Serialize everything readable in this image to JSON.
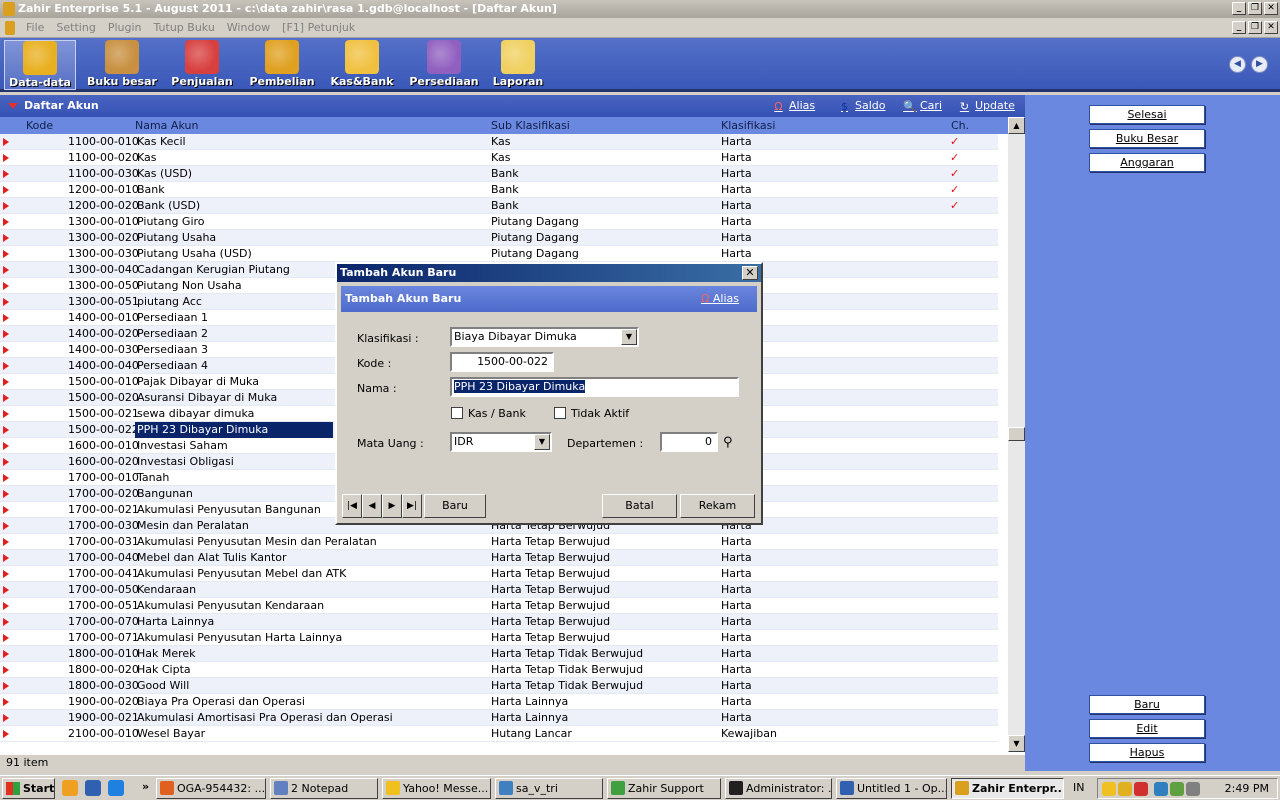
{
  "window": {
    "title": "Zahir Enterprise 5.1 - August 2011 - c:\\data zahir\\rasa 1.gdb@localhost - [Daftar Akun]"
  },
  "menu": [
    "File",
    "Setting",
    "Plugin",
    "Tutup Buku",
    "Window",
    "[F1] Petunjuk"
  ],
  "modules": [
    {
      "label": "Data-data",
      "icon": "data-data-icon",
      "color": "#e8b020"
    },
    {
      "label": "Buku besar",
      "icon": "buku-besar-icon",
      "color": "#c89040"
    },
    {
      "label": "Penjualan",
      "icon": "penjualan-icon",
      "color": "#d84040"
    },
    {
      "label": "Pembelian",
      "icon": "pembelian-icon",
      "color": "#e0a020"
    },
    {
      "label": "Kas&Bank",
      "icon": "kas-bank-icon",
      "color": "#f0c040"
    },
    {
      "label": "Persediaan",
      "icon": "persediaan-icon",
      "color": "#9060c0"
    },
    {
      "label": "Laporan",
      "icon": "laporan-icon",
      "color": "#f0d060"
    }
  ],
  "list": {
    "title": "Daftar Akun",
    "actions": {
      "alias": "Alias",
      "saldo": "Saldo",
      "cari": "Cari",
      "update": "Update"
    },
    "columns": {
      "kode": "Kode",
      "nama": "Nama Akun",
      "sub": "Sub Klasifikasi",
      "klasifikasi": "Klasifikasi",
      "ch": "Ch."
    },
    "rows": [
      {
        "kode": "1100-00-010",
        "nama": "Kas Kecil",
        "sub": "Kas",
        "kla": "Harta",
        "ch": "✓"
      },
      {
        "kode": "1100-00-020",
        "nama": "Kas",
        "sub": "Kas",
        "kla": "Harta",
        "ch": "✓"
      },
      {
        "kode": "1100-00-030",
        "nama": "Kas (USD)",
        "sub": "Bank",
        "kla": "Harta",
        "ch": "✓"
      },
      {
        "kode": "1200-00-010",
        "nama": "Bank",
        "sub": "Bank",
        "kla": "Harta",
        "ch": "✓"
      },
      {
        "kode": "1200-00-020",
        "nama": "Bank (USD)",
        "sub": "Bank",
        "kla": "Harta",
        "ch": "✓"
      },
      {
        "kode": "1300-00-010",
        "nama": "Piutang Giro",
        "sub": "Piutang Dagang",
        "kla": "Harta",
        "ch": ""
      },
      {
        "kode": "1300-00-020",
        "nama": "Piutang Usaha",
        "sub": "Piutang Dagang",
        "kla": "Harta",
        "ch": ""
      },
      {
        "kode": "1300-00-030",
        "nama": "Piutang Usaha (USD)",
        "sub": "Piutang Dagang",
        "kla": "Harta",
        "ch": ""
      },
      {
        "kode": "1300-00-040",
        "nama": "Cadangan Kerugian Piutang",
        "sub": "",
        "kla": "",
        "ch": ""
      },
      {
        "kode": "1300-00-050",
        "nama": "Piutang Non Usaha",
        "sub": "",
        "kla": "",
        "ch": ""
      },
      {
        "kode": "1300-00-051",
        "nama": "piutang Acc",
        "sub": "",
        "kla": "",
        "ch": ""
      },
      {
        "kode": "1400-00-010",
        "nama": "Persediaan 1",
        "sub": "",
        "kla": "",
        "ch": ""
      },
      {
        "kode": "1400-00-020",
        "nama": "Persediaan 2",
        "sub": "",
        "kla": "",
        "ch": ""
      },
      {
        "kode": "1400-00-030",
        "nama": "Persediaan 3",
        "sub": "",
        "kla": "",
        "ch": ""
      },
      {
        "kode": "1400-00-040",
        "nama": "Persediaan 4",
        "sub": "",
        "kla": "",
        "ch": ""
      },
      {
        "kode": "1500-00-010",
        "nama": "Pajak Dibayar di Muka",
        "sub": "",
        "kla": "",
        "ch": ""
      },
      {
        "kode": "1500-00-020",
        "nama": "Asuransi Dibayar di Muka",
        "sub": "",
        "kla": "",
        "ch": ""
      },
      {
        "kode": "1500-00-021",
        "nama": "sewa dibayar dimuka",
        "sub": "",
        "kla": "",
        "ch": ""
      },
      {
        "kode": "1500-00-022",
        "nama": "PPH 23 Dibayar Dimuka",
        "sub": "",
        "kla": "",
        "ch": "",
        "selected": true
      },
      {
        "kode": "1600-00-010",
        "nama": "Investasi Saham",
        "sub": "",
        "kla": "",
        "ch": ""
      },
      {
        "kode": "1600-00-020",
        "nama": "Investasi Obligasi",
        "sub": "",
        "kla": "",
        "ch": ""
      },
      {
        "kode": "1700-00-010",
        "nama": "Tanah",
        "sub": "",
        "kla": "",
        "ch": ""
      },
      {
        "kode": "1700-00-020",
        "nama": "Bangunan",
        "sub": "",
        "kla": "",
        "ch": ""
      },
      {
        "kode": "1700-00-021",
        "nama": "Akumulasi Penyusutan Bangunan",
        "sub": "",
        "kla": "",
        "ch": ""
      },
      {
        "kode": "1700-00-030",
        "nama": "Mesin dan Peralatan",
        "sub": "Harta Tetap Berwujud",
        "kla": "Harta",
        "ch": ""
      },
      {
        "kode": "1700-00-031",
        "nama": "Akumulasi Penyusutan Mesin dan Peralatan",
        "sub": "Harta Tetap Berwujud",
        "kla": "Harta",
        "ch": ""
      },
      {
        "kode": "1700-00-040",
        "nama": "Mebel dan Alat Tulis Kantor",
        "sub": "Harta Tetap Berwujud",
        "kla": "Harta",
        "ch": ""
      },
      {
        "kode": "1700-00-041",
        "nama": "Akumulasi Penyusutan Mebel dan ATK",
        "sub": "Harta Tetap Berwujud",
        "kla": "Harta",
        "ch": ""
      },
      {
        "kode": "1700-00-050",
        "nama": "Kendaraan",
        "sub": "Harta Tetap Berwujud",
        "kla": "Harta",
        "ch": ""
      },
      {
        "kode": "1700-00-051",
        "nama": "Akumulasi Penyusutan Kendaraan",
        "sub": "Harta Tetap Berwujud",
        "kla": "Harta",
        "ch": ""
      },
      {
        "kode": "1700-00-070",
        "nama": "Harta Lainnya",
        "sub": "Harta Tetap Berwujud",
        "kla": "Harta",
        "ch": ""
      },
      {
        "kode": "1700-00-071",
        "nama": "Akumulasi Penyusutan Harta Lainnya",
        "sub": "Harta Tetap Berwujud",
        "kla": "Harta",
        "ch": ""
      },
      {
        "kode": "1800-00-010",
        "nama": "Hak Merek",
        "sub": "Harta Tetap Tidak Berwujud",
        "kla": "Harta",
        "ch": ""
      },
      {
        "kode": "1800-00-020",
        "nama": "Hak Cipta",
        "sub": "Harta Tetap Tidak Berwujud",
        "kla": "Harta",
        "ch": ""
      },
      {
        "kode": "1800-00-030",
        "nama": "Good Will",
        "sub": "Harta Tetap Tidak Berwujud",
        "kla": "Harta",
        "ch": ""
      },
      {
        "kode": "1900-00-020",
        "nama": "Biaya Pra Operasi dan Operasi",
        "sub": "Harta Lainnya",
        "kla": "Harta",
        "ch": ""
      },
      {
        "kode": "1900-00-021",
        "nama": "Akumulasi Amortisasi Pra Operasi dan Operasi",
        "sub": "Harta Lainnya",
        "kla": "Harta",
        "ch": ""
      },
      {
        "kode": "2100-00-010",
        "nama": "Wesel Bayar",
        "sub": "Hutang Lancar",
        "kla": "Kewajiban",
        "ch": ""
      }
    ],
    "status": "91 item"
  },
  "sidebar": {
    "top": [
      "Selesai",
      "Buku Besar",
      "Anggaran"
    ],
    "bottom": [
      "Baru",
      "Edit",
      "Hapus"
    ]
  },
  "dialog": {
    "title": "Tambah Akun Baru",
    "header": "Tambah Akun Baru",
    "alias": "Alias",
    "klasifikasi_label": "Klasifikasi :",
    "klasifikasi_value": "Biaya Dibayar Dimuka",
    "kode_label": "Kode :",
    "kode_value": "1500-00-022",
    "nama_label": "Nama :",
    "nama_value": "PPH 23 Dibayar Dimuka",
    "kasbank_label": "Kas / Bank",
    "tidakaktif_label": "Tidak Aktif",
    "matauang_label": "Mata Uang :",
    "matauang_value": "IDR",
    "departemen_label": "Departemen :",
    "departemen_value": "0",
    "baru": "Baru",
    "batal": "Batal",
    "rekam": "Rekam"
  },
  "taskbar": {
    "start": "Start",
    "tasks": [
      {
        "label": "OGA-954432: ...",
        "color": "#e06020"
      },
      {
        "label": "2 Notepad",
        "color": "#6080c0"
      },
      {
        "label": "Yahoo! Messe...",
        "color": "#f0c020"
      },
      {
        "label": "sa_v_tri",
        "color": "#4080c0"
      },
      {
        "label": "Zahir Support",
        "color": "#40a040"
      },
      {
        "label": "Administrator: ...",
        "color": "#202020"
      },
      {
        "label": "Untitled 1 - Op...",
        "color": "#3060b0"
      },
      {
        "label": "Zahir Enterpr...",
        "color": "#d9a020",
        "active": true
      }
    ],
    "lang": "IN",
    "clock": "2:49 PM"
  }
}
